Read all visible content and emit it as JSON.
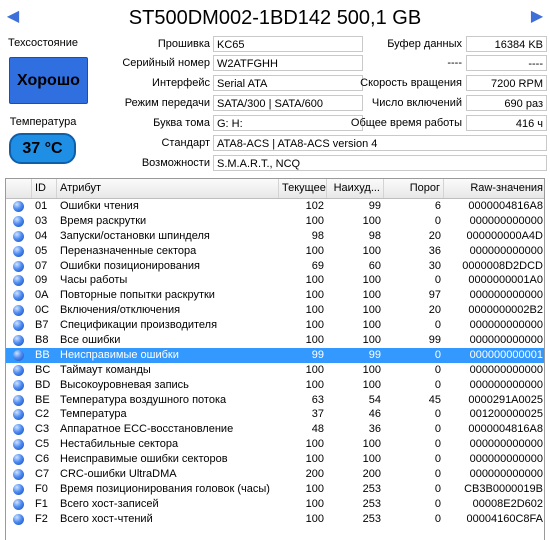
{
  "colors": {
    "health": "#2f6fe0",
    "temperature": "#1f8fe6",
    "selection": "#3399ff",
    "status_dot": "#2f6fe0"
  },
  "nav": {
    "prev_icon": "◀",
    "next_icon": "▶"
  },
  "drive": {
    "title": "ST500DM002-1BD142 500,1 GB"
  },
  "health": {
    "label": "Техсостояние",
    "status": "Хорошо"
  },
  "temperature": {
    "label": "Температура",
    "value": "37 °C"
  },
  "info": {
    "firmware_label": "Прошивка",
    "firmware": "KC65",
    "serial_label": "Серийный номер",
    "serial": "W2ATFGHH",
    "interface_label": "Интерфейс",
    "interface": "Serial ATA",
    "transfer_label": "Режим передачи",
    "transfer": "SATA/300 | SATA/600",
    "drive_letter_label": "Буква тома",
    "drive_letter": "G: H:",
    "standard_label": "Стандарт",
    "standard": "ATA8-ACS | ATA8-ACS version 4",
    "features_label": "Возможности",
    "features": "S.M.A.R.T., NCQ",
    "buffer_label": "Буфер данных",
    "buffer": "16384 KB",
    "blank1_label": "----",
    "blank1": "----",
    "rotation_label": "Скорость вращения",
    "rotation": "7200 RPM",
    "power_on_count_label": "Число включений",
    "power_on_count": "690 раз",
    "power_on_hours_label": "Общее время работы",
    "power_on_hours": "416 ч"
  },
  "table": {
    "headers": {
      "id": "ID",
      "attr": "Атрибут",
      "current": "Текущее",
      "worst": "Наихуд...",
      "threshold": "Порог",
      "raw": "Raw-значения"
    },
    "rows": [
      {
        "id": "01",
        "attr": "Ошибки чтения",
        "current": "102",
        "worst": "99",
        "threshold": "6",
        "raw": "0000004816A8"
      },
      {
        "id": "03",
        "attr": "Время раскрутки",
        "current": "100",
        "worst": "100",
        "threshold": "0",
        "raw": "000000000000"
      },
      {
        "id": "04",
        "attr": "Запуски/остановки шпинделя",
        "current": "98",
        "worst": "98",
        "threshold": "20",
        "raw": "000000000A4D"
      },
      {
        "id": "05",
        "attr": "Переназначенные сектора",
        "current": "100",
        "worst": "100",
        "threshold": "36",
        "raw": "000000000000"
      },
      {
        "id": "07",
        "attr": "Ошибки позиционирования",
        "current": "69",
        "worst": "60",
        "threshold": "30",
        "raw": "0000008D2DCD"
      },
      {
        "id": "09",
        "attr": "Часы работы",
        "current": "100",
        "worst": "100",
        "threshold": "0",
        "raw": "0000000001A0"
      },
      {
        "id": "0A",
        "attr": "Повторные попытки раскрутки",
        "current": "100",
        "worst": "100",
        "threshold": "97",
        "raw": "000000000000"
      },
      {
        "id": "0C",
        "attr": "Включения/отключения",
        "current": "100",
        "worst": "100",
        "threshold": "20",
        "raw": "0000000002B2"
      },
      {
        "id": "B7",
        "attr": "Спецификации производителя",
        "current": "100",
        "worst": "100",
        "threshold": "0",
        "raw": "000000000000"
      },
      {
        "id": "B8",
        "attr": "Все ошибки",
        "current": "100",
        "worst": "100",
        "threshold": "99",
        "raw": "000000000000"
      },
      {
        "id": "BB",
        "attr": "Неисправимые ошибки",
        "current": "99",
        "worst": "99",
        "threshold": "0",
        "raw": "000000000001"
      },
      {
        "id": "BC",
        "attr": "Таймаут команды",
        "current": "100",
        "worst": "100",
        "threshold": "0",
        "raw": "000000000000"
      },
      {
        "id": "BD",
        "attr": "Высокоуровневая запись",
        "current": "100",
        "worst": "100",
        "threshold": "0",
        "raw": "000000000000"
      },
      {
        "id": "BE",
        "attr": "Температура воздушного потока",
        "current": "63",
        "worst": "54",
        "threshold": "45",
        "raw": "0000291A0025"
      },
      {
        "id": "C2",
        "attr": "Температура",
        "current": "37",
        "worst": "46",
        "threshold": "0",
        "raw": "001200000025"
      },
      {
        "id": "C3",
        "attr": "Аппаратное ECC-восстановление",
        "current": "48",
        "worst": "36",
        "threshold": "0",
        "raw": "0000004816A8"
      },
      {
        "id": "C5",
        "attr": "Нестабильные сектора",
        "current": "100",
        "worst": "100",
        "threshold": "0",
        "raw": "000000000000"
      },
      {
        "id": "C6",
        "attr": "Неисправимые ошибки секторов",
        "current": "100",
        "worst": "100",
        "threshold": "0",
        "raw": "000000000000"
      },
      {
        "id": "C7",
        "attr": "CRC-ошибки UltraDMA",
        "current": "200",
        "worst": "200",
        "threshold": "0",
        "raw": "000000000000"
      },
      {
        "id": "F0",
        "attr": "Время позиционирования головок (часы)",
        "current": "100",
        "worst": "253",
        "threshold": "0",
        "raw": "CB3B0000019B"
      },
      {
        "id": "F1",
        "attr": "Всего хост-записей",
        "current": "100",
        "worst": "253",
        "threshold": "0",
        "raw": "00008E2D602"
      },
      {
        "id": "F2",
        "attr": "Всего хост-чтений",
        "current": "100",
        "worst": "253",
        "threshold": "0",
        "raw": "00004160C8FA"
      }
    ]
  }
}
